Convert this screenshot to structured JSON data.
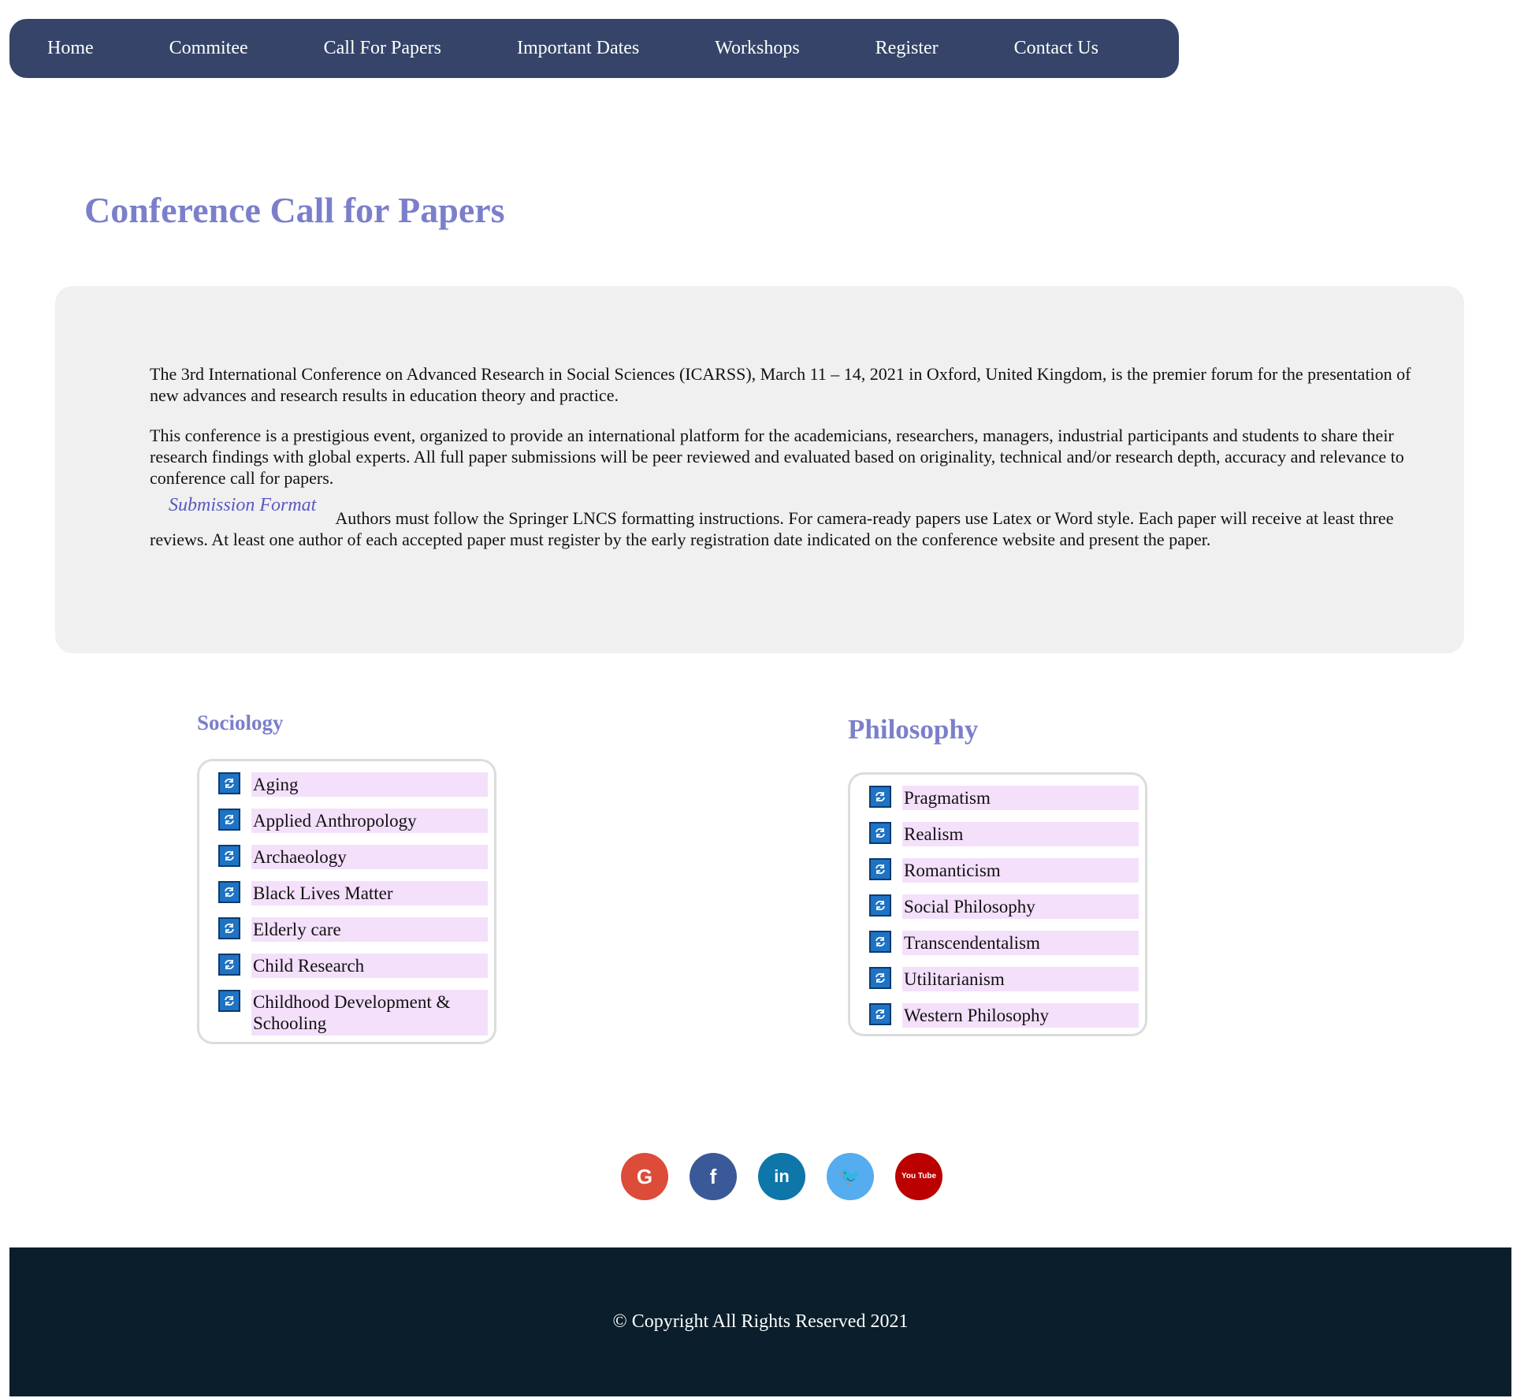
{
  "nav": {
    "items": [
      "Home",
      "Commitee",
      "Call For Papers",
      "Important Dates",
      "Workshops",
      "Register",
      "Contact Us"
    ]
  },
  "page_title": "Conference Call for Papers",
  "intro": {
    "paragraph1": "The 3rd International Conference on Advanced Research in Social Sciences (ICARSS), March 11 – 14, 2021 in Oxford, United Kingdom, is the premier forum for the presentation of new advances and research results in education theory and practice.",
    "paragraph2": "This conference is a prestigious event, organized to provide an international platform for the academicians, researchers, managers, industrial participants and students to share their research findings with global experts. All full paper submissions will be peer reviewed and evaluated based on originality, technical and/or research depth, accuracy and relevance to conference call for papers.",
    "submission_heading": "Submission Format",
    "submission_text": "Authors must follow the Springer LNCS formatting instructions. For camera-ready papers use Latex or Word style. Each paper will receive at least three reviews. At least one author of each accepted paper must register by the early registration date indicated on the conference website and present the paper."
  },
  "sociology": {
    "heading": "Sociology",
    "items": [
      "Aging",
      "Applied Anthropology",
      "Archaeology",
      "Black Lives Matter",
      "Elderly care",
      "Child Research",
      "Childhood Development & Schooling"
    ]
  },
  "philosophy": {
    "heading": "Philosophy",
    "items": [
      "Pragmatism",
      "Realism",
      "Romanticism",
      "Social Philosophy",
      "Transcendentalism",
      "Utilitarianism",
      "Western Philosophy"
    ]
  },
  "social": [
    {
      "name": "google",
      "glyph": "G",
      "color": "#dd4b39"
    },
    {
      "name": "facebook",
      "glyph": "f",
      "color": "#3b5998"
    },
    {
      "name": "linkedin",
      "glyph": "in",
      "color": "#0e76a8"
    },
    {
      "name": "twitter",
      "glyph": "🐦",
      "color": "#55acee"
    },
    {
      "name": "youtube",
      "glyph": "You Tube",
      "color": "#bb0000"
    }
  ],
  "footer": {
    "copyright": "© Copyright All Rights Reserved 2021"
  },
  "colors": {
    "nav_bg": "#354468",
    "title": "#7b7fcb",
    "panel_bg": "#f0f0f0",
    "item_bg": "#f4e0fb",
    "icon_bg": "#1f73c4",
    "footer_bg": "#0a1e2b"
  },
  "icons": {
    "topic_bullet": "refresh-icon"
  }
}
